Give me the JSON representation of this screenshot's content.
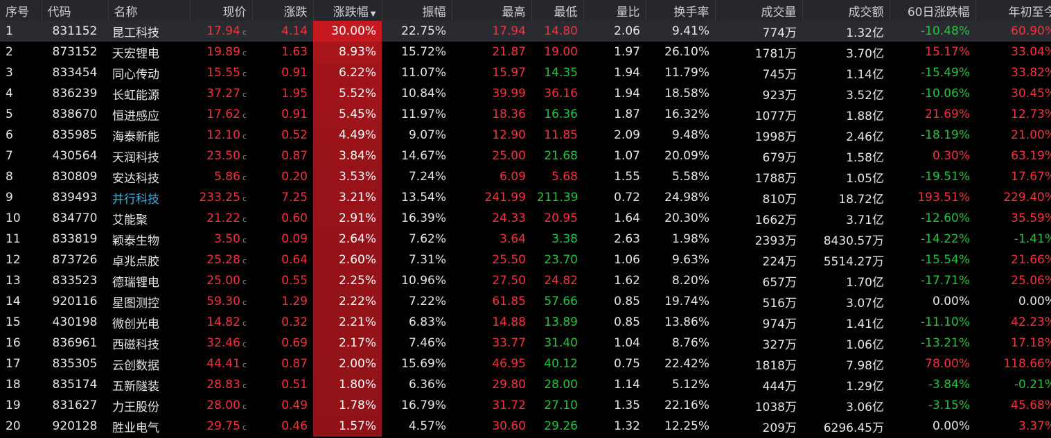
{
  "colors": {
    "up": "#f0343e",
    "down": "#27c23f",
    "pct_bg_max": "#c41a1f",
    "header_bg": "#26272b"
  },
  "headers": [
    "序号",
    "代码",
    "名称",
    "现价",
    "涨跌",
    "涨跌幅",
    "振幅",
    "最高",
    "最低",
    "量比",
    "换手率",
    "成交量",
    "成交额",
    "60日涨跌幅",
    "年初至今"
  ],
  "sort_indicator": "▼",
  "price_suffix": "c",
  "rows": [
    {
      "idx": "1",
      "code": "831152",
      "name": "昆工科技",
      "price": "17.94",
      "chg": "4.14",
      "pct": "30.00%",
      "pct_val": 30.0,
      "amp": "22.75%",
      "high": "17.94",
      "low": "14.80",
      "vr": "2.06",
      "turn": "9.41%",
      "vol": "774万",
      "amt": "1.32亿",
      "d60": "-10.48%",
      "ytd": "60.90%",
      "hi_c": "up",
      "lo_c": "up",
      "d60_c": "down",
      "ytd_c": "up",
      "link": false
    },
    {
      "idx": "2",
      "code": "873152",
      "name": "天宏锂电",
      "price": "19.89",
      "chg": "1.63",
      "pct": "8.93%",
      "pct_val": 8.93,
      "amp": "15.72%",
      "high": "21.87",
      "low": "19.00",
      "vr": "1.97",
      "turn": "26.10%",
      "vol": "1781万",
      "amt": "3.70亿",
      "d60": "15.17%",
      "ytd": "33.04%",
      "hi_c": "up",
      "lo_c": "up",
      "d60_c": "up",
      "ytd_c": "up",
      "link": false
    },
    {
      "idx": "3",
      "code": "833454",
      "name": "同心传动",
      "price": "15.55",
      "chg": "0.91",
      "pct": "6.22%",
      "pct_val": 6.22,
      "amp": "11.07%",
      "high": "15.97",
      "low": "14.35",
      "vr": "1.94",
      "turn": "11.79%",
      "vol": "745万",
      "amt": "1.14亿",
      "d60": "-15.49%",
      "ytd": "33.82%",
      "hi_c": "up",
      "lo_c": "down",
      "d60_c": "down",
      "ytd_c": "up",
      "link": false
    },
    {
      "idx": "4",
      "code": "836239",
      "name": "长虹能源",
      "price": "37.27",
      "chg": "1.95",
      "pct": "5.52%",
      "pct_val": 5.52,
      "amp": "10.84%",
      "high": "39.99",
      "low": "36.16",
      "vr": "1.94",
      "turn": "18.58%",
      "vol": "923万",
      "amt": "3.52亿",
      "d60": "-10.06%",
      "ytd": "30.45%",
      "hi_c": "up",
      "lo_c": "up",
      "d60_c": "down",
      "ytd_c": "up",
      "link": false
    },
    {
      "idx": "5",
      "code": "838670",
      "name": "恒进感应",
      "price": "17.62",
      "chg": "0.91",
      "pct": "5.45%",
      "pct_val": 5.45,
      "amp": "11.97%",
      "high": "18.36",
      "low": "16.36",
      "vr": "1.87",
      "turn": "16.32%",
      "vol": "1077万",
      "amt": "1.88亿",
      "d60": "21.69%",
      "ytd": "12.73%",
      "hi_c": "up",
      "lo_c": "down",
      "d60_c": "up",
      "ytd_c": "up",
      "link": false
    },
    {
      "idx": "6",
      "code": "835985",
      "name": "海泰新能",
      "price": "12.10",
      "chg": "0.52",
      "pct": "4.49%",
      "pct_val": 4.49,
      "amp": "9.07%",
      "high": "12.90",
      "low": "11.85",
      "vr": "2.09",
      "turn": "9.48%",
      "vol": "1998万",
      "amt": "2.46亿",
      "d60": "-18.19%",
      "ytd": "21.00%",
      "hi_c": "up",
      "lo_c": "up",
      "d60_c": "down",
      "ytd_c": "up",
      "link": false
    },
    {
      "idx": "7",
      "code": "430564",
      "name": "天润科技",
      "price": "23.50",
      "chg": "0.87",
      "pct": "3.84%",
      "pct_val": 3.84,
      "amp": "14.67%",
      "high": "25.00",
      "low": "21.68",
      "vr": "1.07",
      "turn": "20.09%",
      "vol": "679万",
      "amt": "1.58亿",
      "d60": "0.30%",
      "ytd": "63.19%",
      "hi_c": "up",
      "lo_c": "down",
      "d60_c": "up",
      "ytd_c": "up",
      "link": false
    },
    {
      "idx": "8",
      "code": "830809",
      "name": "安达科技",
      "price": "5.86",
      "chg": "0.20",
      "pct": "3.53%",
      "pct_val": 3.53,
      "amp": "7.24%",
      "high": "6.09",
      "low": "5.68",
      "vr": "1.55",
      "turn": "5.58%",
      "vol": "1788万",
      "amt": "1.05亿",
      "d60": "-19.51%",
      "ytd": "17.67%",
      "hi_c": "up",
      "lo_c": "up",
      "d60_c": "down",
      "ytd_c": "up",
      "link": false
    },
    {
      "idx": "9",
      "code": "839493",
      "name": "并行科技",
      "price": "233.25",
      "chg": "7.25",
      "pct": "3.21%",
      "pct_val": 3.21,
      "amp": "13.54%",
      "high": "241.99",
      "low": "211.39",
      "vr": "0.72",
      "turn": "24.98%",
      "vol": "810万",
      "amt": "18.72亿",
      "d60": "193.51%",
      "ytd": "229.40%",
      "hi_c": "up",
      "lo_c": "down",
      "d60_c": "up",
      "ytd_c": "up",
      "link": true
    },
    {
      "idx": "10",
      "code": "834770",
      "name": "艾能聚",
      "price": "21.22",
      "chg": "0.60",
      "pct": "2.91%",
      "pct_val": 2.91,
      "amp": "16.39%",
      "high": "24.33",
      "low": "20.95",
      "vr": "1.64",
      "turn": "20.30%",
      "vol": "1662万",
      "amt": "3.71亿",
      "d60": "-12.60%",
      "ytd": "35.59%",
      "hi_c": "up",
      "lo_c": "up",
      "d60_c": "down",
      "ytd_c": "up",
      "link": false
    },
    {
      "idx": "11",
      "code": "833819",
      "name": "颖泰生物",
      "price": "3.50",
      "chg": "0.09",
      "pct": "2.64%",
      "pct_val": 2.64,
      "amp": "7.62%",
      "high": "3.64",
      "low": "3.38",
      "vr": "2.63",
      "turn": "1.98%",
      "vol": "2393万",
      "amt": "8430.57万",
      "d60": "-14.22%",
      "ytd": "-1.41%",
      "hi_c": "up",
      "lo_c": "down",
      "d60_c": "down",
      "ytd_c": "down",
      "link": false
    },
    {
      "idx": "12",
      "code": "873726",
      "name": "卓兆点胶",
      "price": "25.28",
      "chg": "0.64",
      "pct": "2.60%",
      "pct_val": 2.6,
      "amp": "7.31%",
      "high": "25.50",
      "low": "23.70",
      "vr": "1.06",
      "turn": "9.63%",
      "vol": "224万",
      "amt": "5514.27万",
      "d60": "-15.54%",
      "ytd": "21.66%",
      "hi_c": "up",
      "lo_c": "down",
      "d60_c": "down",
      "ytd_c": "up",
      "link": false
    },
    {
      "idx": "13",
      "code": "833523",
      "name": "德瑞锂电",
      "price": "25.00",
      "chg": "0.55",
      "pct": "2.25%",
      "pct_val": 2.25,
      "amp": "10.96%",
      "high": "27.50",
      "low": "24.82",
      "vr": "1.62",
      "turn": "8.20%",
      "vol": "657万",
      "amt": "1.70亿",
      "d60": "-17.71%",
      "ytd": "25.06%",
      "hi_c": "up",
      "lo_c": "up",
      "d60_c": "down",
      "ytd_c": "up",
      "link": false
    },
    {
      "idx": "14",
      "code": "920116",
      "name": "星图测控",
      "price": "59.30",
      "chg": "1.29",
      "pct": "2.22%",
      "pct_val": 2.22,
      "amp": "7.22%",
      "high": "61.85",
      "low": "57.66",
      "vr": "0.85",
      "turn": "19.74%",
      "vol": "516万",
      "amt": "3.07亿",
      "d60": "0.00%",
      "ytd": "0.00%",
      "hi_c": "up",
      "lo_c": "down",
      "d60_c": "flat",
      "ytd_c": "flat",
      "link": false
    },
    {
      "idx": "15",
      "code": "430198",
      "name": "微创光电",
      "price": "14.82",
      "chg": "0.32",
      "pct": "2.21%",
      "pct_val": 2.21,
      "amp": "6.83%",
      "high": "14.88",
      "low": "13.89",
      "vr": "0.85",
      "turn": "13.86%",
      "vol": "974万",
      "amt": "1.41亿",
      "d60": "-11.10%",
      "ytd": "42.23%",
      "hi_c": "up",
      "lo_c": "down",
      "d60_c": "down",
      "ytd_c": "up",
      "link": false
    },
    {
      "idx": "16",
      "code": "836961",
      "name": "西磁科技",
      "price": "32.46",
      "chg": "0.69",
      "pct": "2.17%",
      "pct_val": 2.17,
      "amp": "7.46%",
      "high": "33.77",
      "low": "31.40",
      "vr": "1.04",
      "turn": "8.76%",
      "vol": "327万",
      "amt": "1.06亿",
      "d60": "-13.21%",
      "ytd": "17.18%",
      "hi_c": "up",
      "lo_c": "down",
      "d60_c": "down",
      "ytd_c": "up",
      "link": false
    },
    {
      "idx": "17",
      "code": "835305",
      "name": "云创数据",
      "price": "44.41",
      "chg": "0.87",
      "pct": "2.00%",
      "pct_val": 2.0,
      "amp": "15.69%",
      "high": "46.95",
      "low": "40.12",
      "vr": "0.75",
      "turn": "22.42%",
      "vol": "1818万",
      "amt": "7.98亿",
      "d60": "78.00%",
      "ytd": "118.66%",
      "hi_c": "up",
      "lo_c": "down",
      "d60_c": "up",
      "ytd_c": "up",
      "link": false
    },
    {
      "idx": "18",
      "code": "835174",
      "name": "五新隧装",
      "price": "28.83",
      "chg": "0.51",
      "pct": "1.80%",
      "pct_val": 1.8,
      "amp": "6.36%",
      "high": "29.80",
      "low": "28.00",
      "vr": "1.14",
      "turn": "5.12%",
      "vol": "444万",
      "amt": "1.29亿",
      "d60": "-3.84%",
      "ytd": "-0.21%",
      "hi_c": "up",
      "lo_c": "down",
      "d60_c": "down",
      "ytd_c": "down",
      "link": false
    },
    {
      "idx": "19",
      "code": "831627",
      "name": "力王股份",
      "price": "28.00",
      "chg": "0.49",
      "pct": "1.78%",
      "pct_val": 1.78,
      "amp": "16.79%",
      "high": "31.72",
      "low": "27.10",
      "vr": "1.35",
      "turn": "22.16%",
      "vol": "1038万",
      "amt": "3.06亿",
      "d60": "-3.15%",
      "ytd": "45.68%",
      "hi_c": "up",
      "lo_c": "down",
      "d60_c": "down",
      "ytd_c": "up",
      "link": false
    },
    {
      "idx": "20",
      "code": "920128",
      "name": "胜业电气",
      "price": "29.75",
      "chg": "0.46",
      "pct": "1.57%",
      "pct_val": 1.57,
      "amp": "4.57%",
      "high": "30.60",
      "low": "29.26",
      "vr": "1.32",
      "turn": "12.25%",
      "vol": "209万",
      "amt": "6296.45万",
      "d60": "0.00%",
      "ytd": "3.37%",
      "hi_c": "up",
      "lo_c": "down",
      "d60_c": "flat",
      "ytd_c": "up",
      "link": false
    }
  ]
}
